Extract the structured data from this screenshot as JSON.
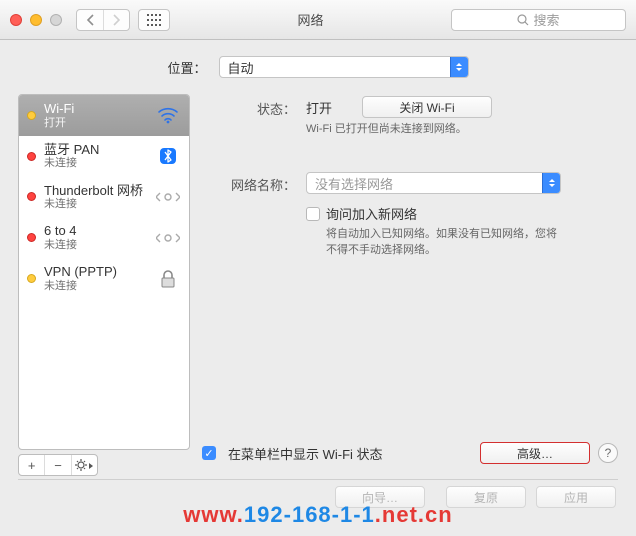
{
  "window": {
    "title": "网络",
    "search_placeholder": "搜索"
  },
  "location": {
    "label": "位置：",
    "value": "自动"
  },
  "sidebar": {
    "items": [
      {
        "name": "Wi-Fi",
        "sub": "打开",
        "status": "yellow",
        "icon": "wifi",
        "selected": true
      },
      {
        "name": "蓝牙 PAN",
        "sub": "未连接",
        "status": "red",
        "icon": "bluetooth",
        "selected": false
      },
      {
        "name": "Thunderbolt 网桥",
        "sub": "未连接",
        "status": "red",
        "icon": "bridge",
        "selected": false
      },
      {
        "name": "6 to 4",
        "sub": "未连接",
        "status": "red",
        "icon": "bridge",
        "selected": false
      },
      {
        "name": "VPN (PPTP)",
        "sub": "未连接",
        "status": "yellow",
        "icon": "lock",
        "selected": false
      }
    ]
  },
  "detail": {
    "status_label": "状态：",
    "status_value": "打开",
    "status_note": "Wi-Fi 已打开但尚未连接到网络。",
    "toggle_button": "关闭 Wi-Fi",
    "network_name_label": "网络名称：",
    "network_name_value": "没有选择网络",
    "ask_join_label": "询问加入新网络",
    "ask_join_note": "将自动加入已知网络。如果没有已知网络，您将不得不手动选择网络。",
    "menubar_checkbox_label": "在菜单栏中显示 Wi-Fi 状态",
    "advanced_button": "高级…",
    "help_tooltip": "?"
  },
  "footer": {
    "wizard": "向导…",
    "revert": "复原",
    "apply": "应用"
  },
  "watermark": {
    "a": "www.",
    "b": "192-168-1-1",
    "c": ".net.cn"
  }
}
